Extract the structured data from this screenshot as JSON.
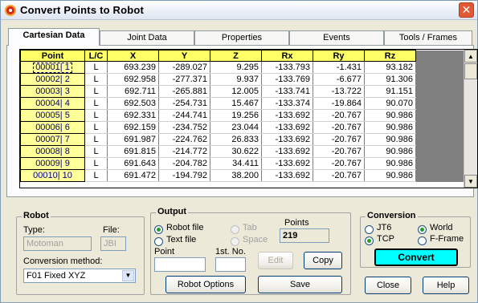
{
  "window": {
    "title": "Convert Points to Robot",
    "close": "✕"
  },
  "tabs": [
    "Cartesian Data",
    "Joint Data",
    "Properties",
    "Events",
    "Tools / Frames"
  ],
  "grid": {
    "columns": [
      "Point",
      "L/C",
      "X",
      "Y",
      "Z",
      "Rx",
      "Ry",
      "Rz"
    ],
    "rows": [
      [
        "00001| 1",
        "L",
        "693.239",
        "-289.027",
        "9.295",
        "-133.793",
        "-1.431",
        "93.182"
      ],
      [
        "00002| 2",
        "L",
        "692.958",
        "-277.371",
        "9.937",
        "-133.769",
        "-6.677",
        "91.306"
      ],
      [
        "00003| 3",
        "L",
        "692.711",
        "-265.881",
        "12.005",
        "-133.741",
        "-13.722",
        "91.151"
      ],
      [
        "00004| 4",
        "L",
        "692.503",
        "-254.731",
        "15.467",
        "-133.374",
        "-19.864",
        "90.070"
      ],
      [
        "00005| 5",
        "L",
        "692.331",
        "-244.741",
        "19.256",
        "-133.692",
        "-20.767",
        "90.986"
      ],
      [
        "00006| 6",
        "L",
        "692.159",
        "-234.752",
        "23.044",
        "-133.692",
        "-20.767",
        "90.986"
      ],
      [
        "00007| 7",
        "L",
        "691.987",
        "-224.762",
        "26.833",
        "-133.692",
        "-20.767",
        "90.986"
      ],
      [
        "00008| 8",
        "L",
        "691.815",
        "-214.772",
        "30.622",
        "-133.692",
        "-20.767",
        "90.986"
      ],
      [
        "00009| 9",
        "L",
        "691.643",
        "-204.782",
        "34.411",
        "-133.692",
        "-20.767",
        "90.986"
      ],
      [
        "00010| 10",
        "L",
        "691.472",
        "-194.792",
        "38.200",
        "-133.692",
        "-20.767",
        "90.986"
      ]
    ]
  },
  "robot": {
    "group": "Robot",
    "type_label": "Type:",
    "type_value": "Motoman",
    "file_label": "File:",
    "file_value": "JBI",
    "method_label": "Conversion method:",
    "method_value": "F01 Fixed XYZ"
  },
  "output": {
    "group": "Output",
    "robot_file": "Robot file",
    "text_file": "Text file",
    "tab": "Tab",
    "space": "Space",
    "points_label": "Points",
    "points_value": "219",
    "point_label": "Point",
    "first_no_label": "1st. No.",
    "edit": "Edit",
    "copy": "Copy",
    "robot_options": "Robot Options",
    "save": "Save"
  },
  "conversion": {
    "group": "Conversion",
    "jt6": "JT6",
    "world": "World",
    "tcp": "TCP",
    "fframe": "F-Frame",
    "convert": "Convert"
  },
  "footer": {
    "close": "Close",
    "help": "Help"
  }
}
